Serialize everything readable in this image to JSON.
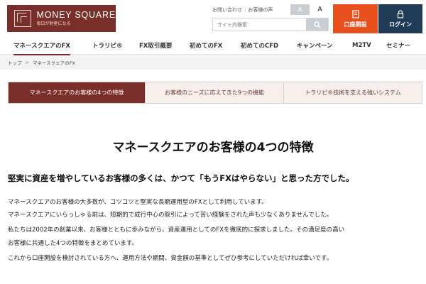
{
  "header": {
    "logo_title": "MONEY SQUARE",
    "logo_subtitle": "毎日が財産になる",
    "contact_link": "お問い合わせ",
    "voice_link": "お客様の声",
    "font_small": "A",
    "font_large": "A",
    "search_placeholder": "サイト内検索",
    "account_button": "口座開設",
    "login_button": "ログイン"
  },
  "nav": {
    "items": [
      {
        "label": "マネースクエアのFX"
      },
      {
        "label": "トラリピ®"
      },
      {
        "label": "FX取引概要"
      },
      {
        "label": "初めてのFX"
      },
      {
        "label": "初めてのCFD"
      },
      {
        "label": "キャンペーン"
      },
      {
        "label": "M2TV"
      },
      {
        "label": "セミナー"
      }
    ]
  },
  "breadcrumb": {
    "home": "トップ",
    "separator": ">",
    "current": "マネースクエアのFX"
  },
  "tabs": [
    {
      "label": "マネースクエアのお客様の4つの特徴"
    },
    {
      "label": "お客様のニーズに応えてきた9つの機能"
    },
    {
      "label": "トラリピ®技術を支える強いシステム"
    }
  ],
  "content": {
    "title": "マネースクエアのお客様の4つの特徴",
    "lead": "堅実に資産を増やしているお客様の多くは、かつて「もうFXはやらない」と思った方でした。",
    "paragraphs": [
      "マネースクエアのお客様の大多数が、コツコツと堅実な長期運用型のFXとして利用しています。",
      "マネースクエアにいらっしゃる前は、短期的で成行中心の取引によって苦い経験をされた声も少なくありませんでした。",
      "私たちは2002年の創業以来、お客様とともに歩みながら、資産運用としてのFXを徹底的に探求しました。その満足度の高い",
      "お客様に共通した4つの特徴をまとめています。",
      "これから口座開設を検討されている方へ、運用方法や期間、資金額の基準としてぜひ参考にしていただければ幸いです。"
    ]
  },
  "colors": {
    "brand": "#7a2e2a",
    "account_orange": "#e8501e",
    "login_navy": "#1f3b56"
  }
}
